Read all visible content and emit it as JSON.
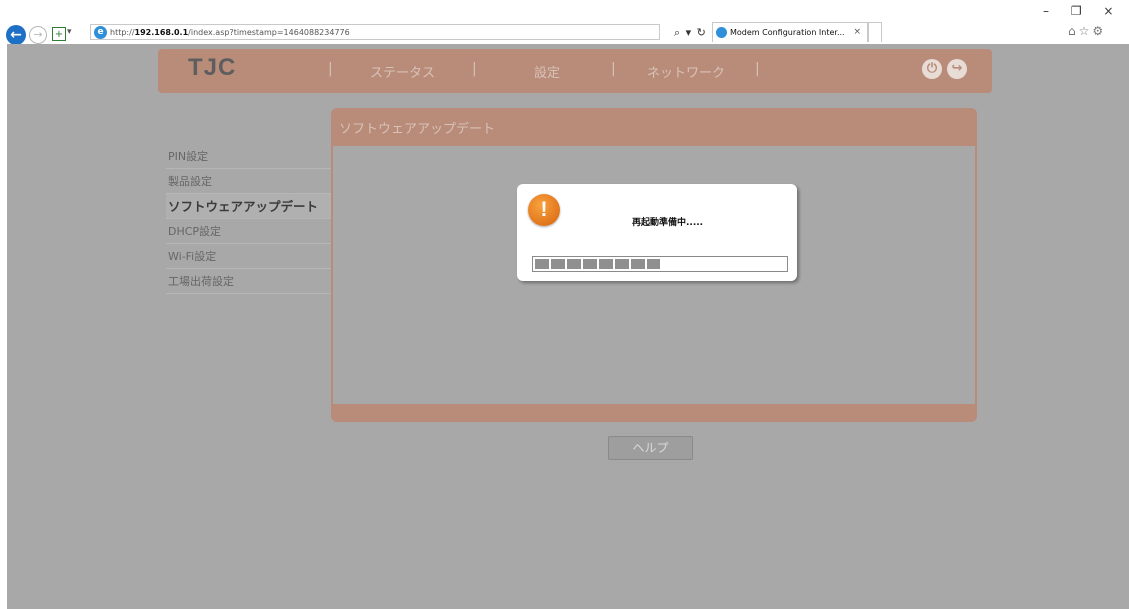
{
  "browser": {
    "url_prefix": "http://",
    "url_host": "192.168.0.1",
    "url_path": "/index.asp?timestamp=1464088234776",
    "tab_title": "Modem Configuration Inter...",
    "tab_close": "×",
    "search_refresh": "⌕ ▾ ↻",
    "window_controls": "– ❐ ×"
  },
  "nav": {
    "logo": "TJC",
    "items": [
      "ステータス",
      "設定",
      "ネットワーク"
    ],
    "separator": "|"
  },
  "menu": {
    "items": [
      "PIN設定",
      "製品設定",
      "ソフトウェアアップデート",
      "DHCP設定",
      "Wi-Fi設定",
      "工場出荷設定"
    ],
    "active_index": 2
  },
  "panel": {
    "title": "ソフトウェアアップデート"
  },
  "help": {
    "label": "ヘルプ"
  },
  "dialog": {
    "message": "再起動準備中.....",
    "progress": 0.5
  },
  "colors": {
    "accent": "#b98c7a",
    "page_bg": "#a8a8a8",
    "warning": "#e8791f"
  }
}
